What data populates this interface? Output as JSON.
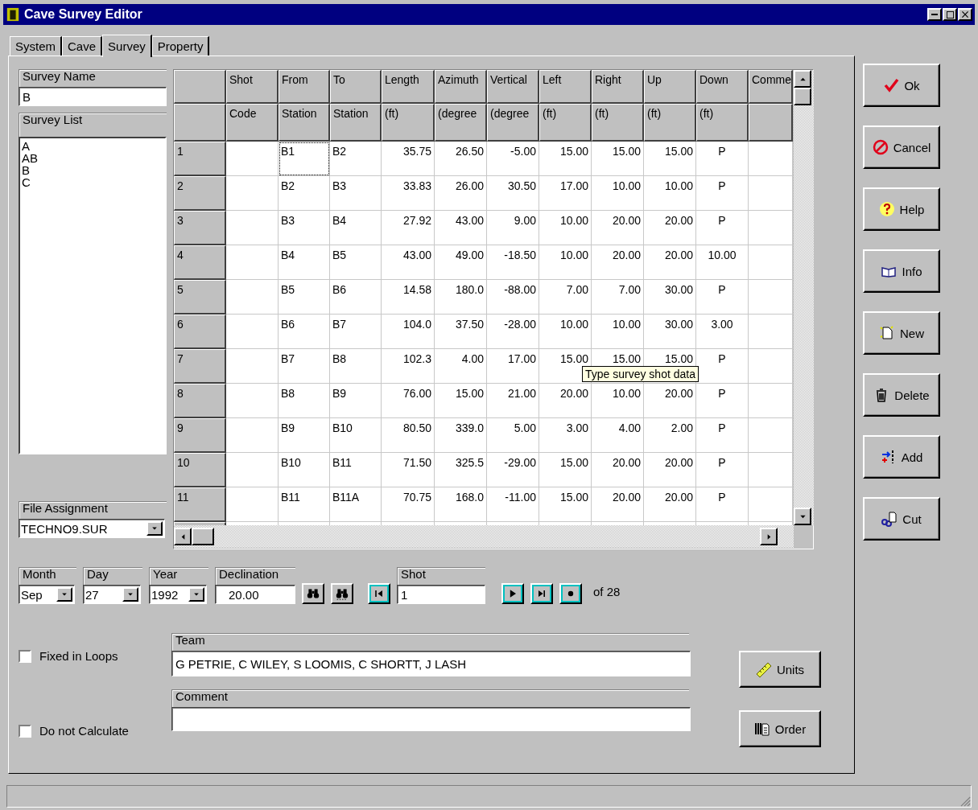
{
  "window": {
    "title": "Cave Survey Editor"
  },
  "tabs": [
    {
      "label": "System",
      "selected": false
    },
    {
      "label": "Cave",
      "selected": false
    },
    {
      "label": "Survey",
      "selected": true
    },
    {
      "label": "Property",
      "selected": false
    }
  ],
  "survey_name": {
    "label": "Survey Name",
    "value": "B"
  },
  "survey_list": {
    "label": "Survey List",
    "items": [
      {
        "label": "A",
        "selected": false
      },
      {
        "label": "AB",
        "selected": false
      },
      {
        "label": "B",
        "selected": false
      },
      {
        "label": "C",
        "selected": false
      }
    ]
  },
  "file_assignment": {
    "label": "File Assignment",
    "value": "TECHNO9.SUR"
  },
  "grid": {
    "columns": [
      {
        "kind": "text",
        "line1": "Shot",
        "line2": "Code"
      },
      {
        "kind": "text",
        "line1": "From",
        "line2": "Station"
      },
      {
        "kind": "text",
        "line1": "To",
        "line2": "Station"
      },
      {
        "kind": "number",
        "line1": "Length",
        "line2": "(ft)"
      },
      {
        "kind": "number",
        "line1": "Azimuth",
        "line2": "(degree"
      },
      {
        "kind": "number",
        "line1": "Vertical",
        "line2": "(degree"
      },
      {
        "kind": "number",
        "line1": "Left",
        "line2": "(ft)"
      },
      {
        "kind": "number",
        "line1": "Right",
        "line2": "(ft)"
      },
      {
        "kind": "number",
        "line1": "Up",
        "line2": "(ft)"
      },
      {
        "kind": "center",
        "line1": "Down",
        "line2": "(ft)"
      },
      {
        "kind": "text",
        "line1": "Comme"
      }
    ],
    "rows": [
      {
        "n": "1",
        "focused": true,
        "cells": [
          "",
          "B1",
          "B2",
          "35.75",
          "26.50",
          "-5.00",
          "15.00",
          "15.00",
          "15.00",
          "P"
        ]
      },
      {
        "n": "2",
        "focused": false,
        "cells": [
          "",
          "B2",
          "B3",
          "33.83",
          "26.00",
          "30.50",
          "17.00",
          "10.00",
          "10.00",
          "P"
        ]
      },
      {
        "n": "3",
        "focused": false,
        "cells": [
          "",
          "B3",
          "B4",
          "27.92",
          "43.00",
          "9.00",
          "10.00",
          "20.00",
          "20.00",
          "P"
        ]
      },
      {
        "n": "4",
        "focused": false,
        "cells": [
          "",
          "B4",
          "B5",
          "43.00",
          "49.00",
          "-18.50",
          "10.00",
          "20.00",
          "20.00",
          "10.00"
        ]
      },
      {
        "n": "5",
        "focused": false,
        "cells": [
          "",
          "B5",
          "B6",
          "14.58",
          "180.0",
          "-88.00",
          "7.00",
          "7.00",
          "30.00",
          "P"
        ]
      },
      {
        "n": "6",
        "focused": false,
        "cells": [
          "",
          "B6",
          "B7",
          "104.0",
          "37.50",
          "-28.00",
          "10.00",
          "10.00",
          "30.00",
          "3.00"
        ]
      },
      {
        "n": "7",
        "focused": false,
        "cells": [
          "",
          "B7",
          "B8",
          "102.3",
          "4.00",
          "17.00",
          "15.00",
          "15.00",
          "15.00",
          "P"
        ]
      },
      {
        "n": "8",
        "focused": false,
        "cells": [
          "",
          "B8",
          "B9",
          "76.00",
          "15.00",
          "21.00",
          "20.00",
          "10.00",
          "20.00",
          "P"
        ]
      },
      {
        "n": "9",
        "focused": false,
        "cells": [
          "",
          "B9",
          "B10",
          "80.50",
          "339.0",
          "5.00",
          "3.00",
          "4.00",
          "2.00",
          "P"
        ]
      },
      {
        "n": "10",
        "focused": false,
        "cells": [
          "",
          "B10",
          "B11",
          "71.50",
          "325.5",
          "-29.00",
          "15.00",
          "20.00",
          "20.00",
          "P"
        ]
      },
      {
        "n": "11",
        "focused": false,
        "cells": [
          "",
          "B11",
          "B11A",
          "70.75",
          "168.0",
          "-11.00",
          "15.00",
          "20.00",
          "20.00",
          "P"
        ]
      }
    ],
    "tooltip": "Type survey shot data"
  },
  "month": {
    "label": "Month",
    "value": "Sep"
  },
  "day": {
    "label": "Day",
    "value": "27"
  },
  "year": {
    "label": "Year",
    "value": "1992"
  },
  "declination": {
    "label": "Declination",
    "value": "20.00"
  },
  "shot": {
    "label": "Shot",
    "value": "1",
    "total": "of 28"
  },
  "checkboxes": [
    {
      "label": "Fixed in Loops",
      "checked": false
    },
    {
      "label": "Do not Calculate",
      "checked": false
    }
  ],
  "team": {
    "label": "Team",
    "value": "G PETRIE, C WILEY, S LOOMIS, C SHORTT, J LASH"
  },
  "comment": {
    "label": "Comment"
  },
  "side_buttons": [
    {
      "kind": "ok",
      "label": "Ok"
    },
    {
      "kind": "cancel",
      "label": "Cancel"
    },
    {
      "kind": "help",
      "label": "Help"
    },
    {
      "kind": "info",
      "label": "Info"
    },
    {
      "kind": "new",
      "label": "New"
    },
    {
      "kind": "delete",
      "label": "Delete"
    },
    {
      "kind": "add",
      "label": "Add"
    },
    {
      "kind": "cut",
      "label": "Cut"
    }
  ],
  "panel_buttons": [
    {
      "kind": "units",
      "label": "Units"
    },
    {
      "kind": "order",
      "label": "Order"
    }
  ]
}
